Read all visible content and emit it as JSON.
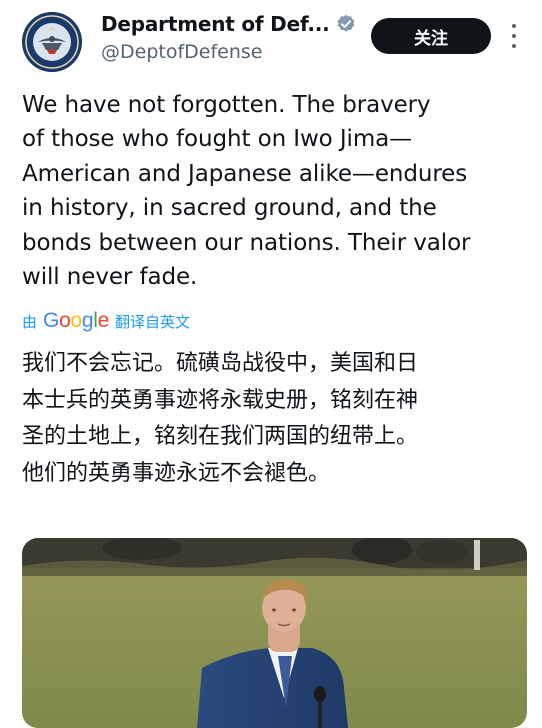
{
  "account": {
    "display_name": "Department of Def...",
    "handle": "@DeptofDefense",
    "verified_badge": "verified-badge-icon",
    "avatar": "dod-seal"
  },
  "actions": {
    "follow_label": "关注",
    "more_icon": "more-vertical-icon"
  },
  "tweet": {
    "lines": [
      "We have not forgotten. The bravery",
      "of those who fought on Iwo Jima—",
      "American and Japanese alike—endures",
      "in history, in sacred ground, and the",
      "bonds between our nations. Their valor",
      "will never fade."
    ]
  },
  "translation_bar": {
    "prefix": "由",
    "provider": "Google",
    "action": "翻译自英文"
  },
  "translation": {
    "lines": [
      "我们不会忘记。硫磺岛战役中，美国和日",
      "本士兵的英勇事迹将永载史册，铭刻在神",
      "圣的土地上，铭刻在我们两国的纽带上。",
      "他们的英勇事迹永远不会褪色。"
    ]
  },
  "colors": {
    "text": "#0f1419",
    "secondary": "#536471",
    "link": "#1d9bf0",
    "follow_bg": "#0f1419",
    "verified": "#829aab"
  }
}
